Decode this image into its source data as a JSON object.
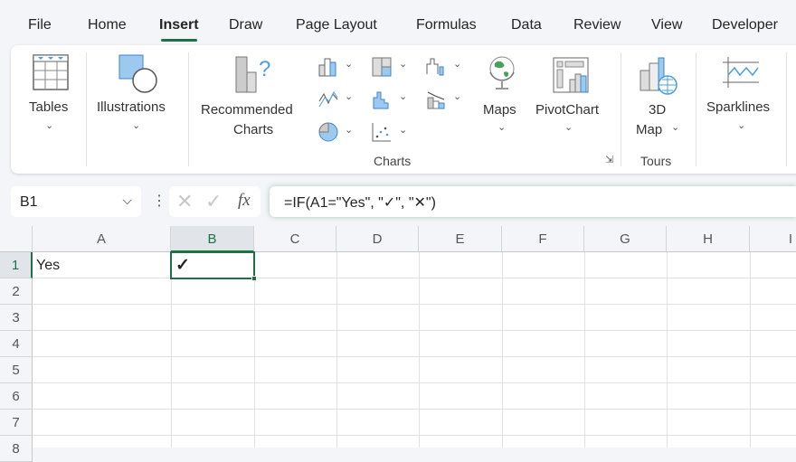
{
  "menu": {
    "tabs": [
      {
        "label": "File"
      },
      {
        "label": "Home"
      },
      {
        "label": "Insert",
        "active": true
      },
      {
        "label": "Draw"
      },
      {
        "label": "Page Layout"
      },
      {
        "label": "Formulas"
      },
      {
        "label": "Data"
      },
      {
        "label": "Review"
      },
      {
        "label": "View"
      },
      {
        "label": "Developer"
      }
    ]
  },
  "ribbon": {
    "tables": "Tables",
    "illustrations": "Illustrations",
    "recommended_1": "Recommended",
    "recommended_2": "Charts",
    "maps": "Maps",
    "pivotchart": "PivotChart",
    "map3d_1": "3D",
    "map3d_2": "Map",
    "sparklines": "Sparklines",
    "charts_group": "Charts",
    "tours_group": "Tours"
  },
  "formula_bar": {
    "name_box": "B1",
    "formula": "=IF(A1=\"Yes\", \"✓\", \"✕\")"
  },
  "sheet": {
    "columns": [
      "A",
      "B",
      "C",
      "D",
      "E",
      "F",
      "G",
      "H",
      "I"
    ],
    "rows": [
      "1",
      "2",
      "3",
      "4",
      "5",
      "6",
      "7",
      "8"
    ],
    "cells": {
      "A1": "Yes",
      "B1": "✓"
    },
    "selected": "B1"
  },
  "colors": {
    "accent": "#1e7145",
    "icon_blue": "#4a9fe0"
  }
}
